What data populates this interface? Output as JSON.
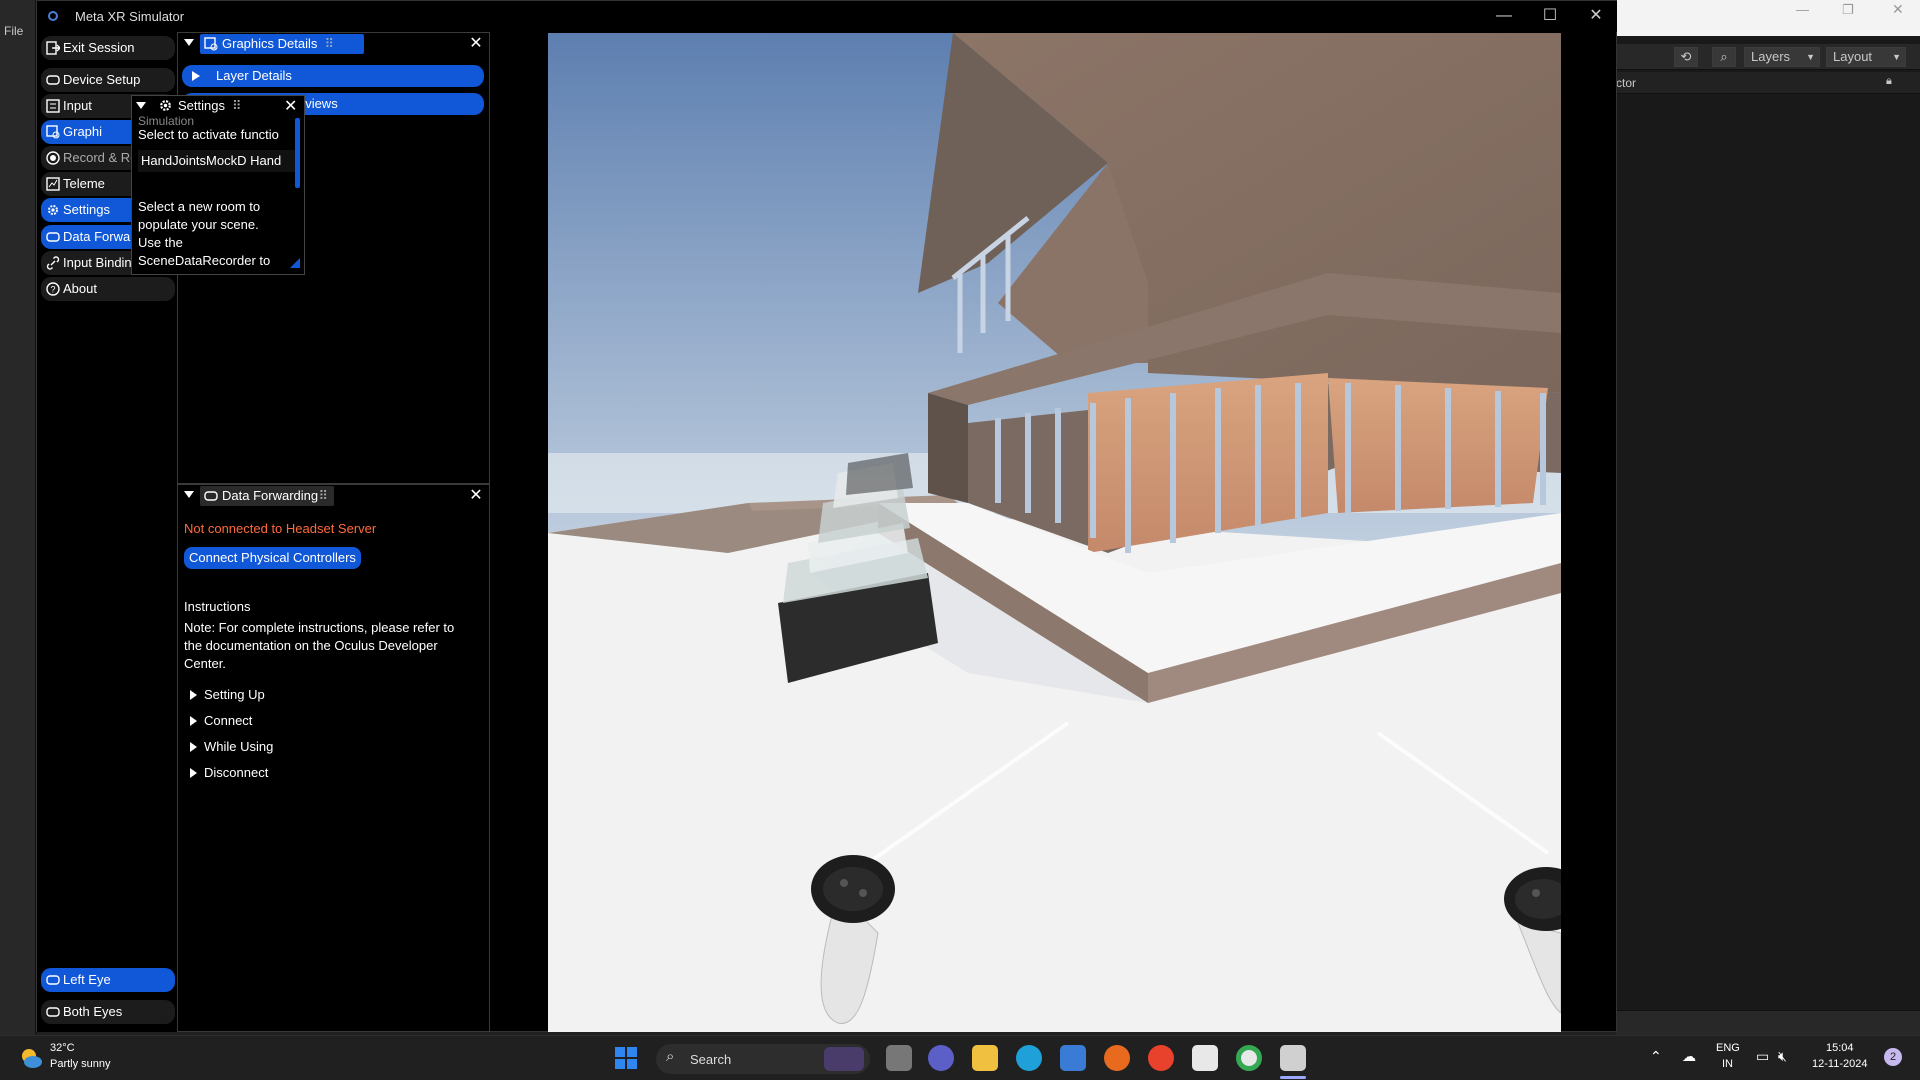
{
  "window": {
    "title": "Meta XR Simulator",
    "min_label": "—",
    "max_label": "☐",
    "close_label": "✕"
  },
  "background": {
    "file_menu": "File",
    "layers_label": "Layers",
    "layout_label": "Layout",
    "inspector_tab": "ctor"
  },
  "nav": {
    "items": [
      {
        "label": "Exit Session",
        "icon": "exit-icon"
      },
      {
        "label": "Device Setup",
        "icon": "headset-icon"
      },
      {
        "label": "Input",
        "icon": "input-icon"
      },
      {
        "label": "Graphi",
        "icon": "graphics-icon"
      },
      {
        "label": "Record & Replay",
        "icon": "record-icon"
      },
      {
        "label": "Teleme",
        "icon": "telemetry-icon"
      },
      {
        "label": "Settings",
        "icon": "gear-icon"
      },
      {
        "label": "Data Forwarding",
        "icon": "headset-icon"
      },
      {
        "label": "Input Bindings",
        "icon": "link-icon"
      },
      {
        "label": "About",
        "icon": "help-icon"
      }
    ],
    "bottom": [
      {
        "label": "Left Eye",
        "icon": "headset-icon"
      },
      {
        "label": "Both Eyes",
        "icon": "headset-icon"
      }
    ]
  },
  "graphics_panel": {
    "title": "Graphics Details",
    "layer_details": "Layer Details",
    "main_previews": "ain Previews"
  },
  "settings_popup": {
    "title": "Settings",
    "section_label": "Simulation",
    "hint1": "Select to activate functio",
    "field_value": "HandJointsMockD Hand",
    "hint2": "Select a new room to populate your scene.",
    "hint3": "Use the SceneDataRecorder to"
  },
  "data_forwarding": {
    "title": "Data Forwarding",
    "status": "Not connected to Headset Server",
    "status_color": "#ff6a3d",
    "connect_button": "Connect Physical Controllers",
    "instructions_heading": "Instructions",
    "note": "Note: For complete instructions, please refer to the documentation on the Oculus Developer Center.",
    "foldouts": [
      "Setting Up",
      "Connect",
      "While Using",
      "Disconnect"
    ]
  },
  "taskbar": {
    "temperature": "32°C",
    "weather": "Partly sunny",
    "search": "Search",
    "lang1": "ENG",
    "lang2": "IN",
    "time": "15:04",
    "date": "12-11-2024",
    "notif_count": "2"
  },
  "colors": {
    "accent": "#1058d8",
    "sky_top": "#6a8ab8",
    "sky_bottom": "#dfe6e8",
    "floor": "#f0f0f0"
  }
}
